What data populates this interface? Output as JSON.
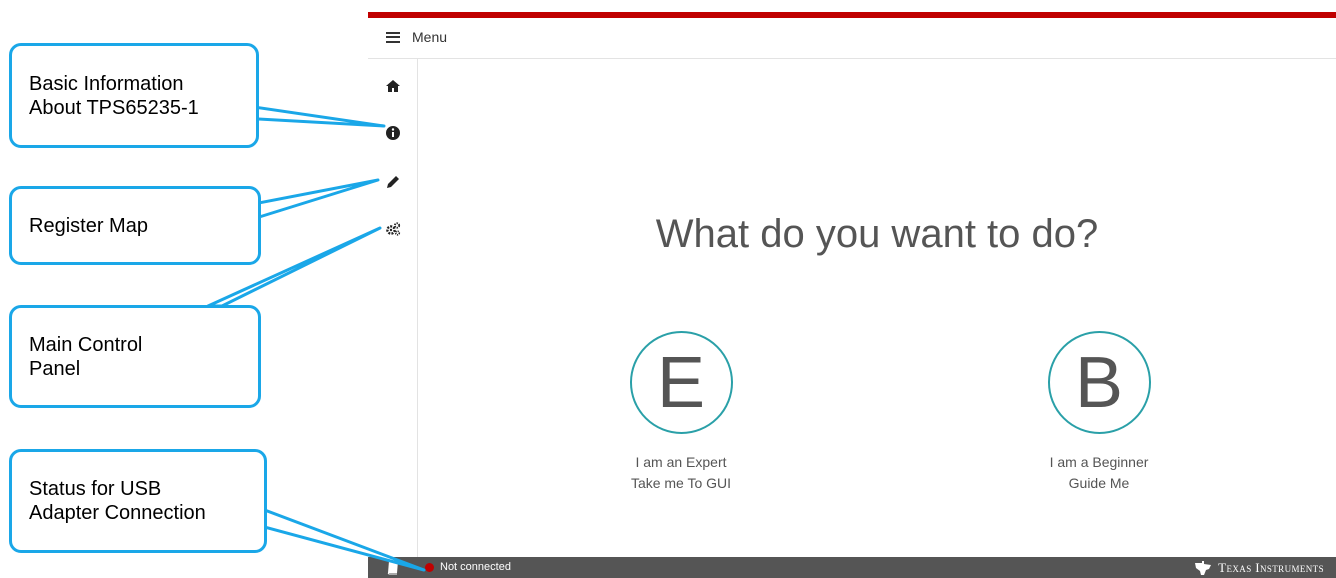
{
  "menu": {
    "label": "Menu"
  },
  "sidebar": {
    "items": [
      {
        "icon": "home-icon"
      },
      {
        "icon": "info-icon"
      },
      {
        "icon": "pencil-icon"
      },
      {
        "icon": "gears-icon"
      }
    ]
  },
  "main": {
    "question": "What do you want to do?",
    "choices": [
      {
        "letter": "E",
        "line1": "I am an Expert",
        "line2": "Take me To GUI"
      },
      {
        "letter": "B",
        "line1": "I am a Beginner",
        "line2": "Guide Me"
      }
    ]
  },
  "status": {
    "text": "Not connected",
    "brand": "Texas Instruments"
  },
  "callouts": {
    "info": "Basic Information\nAbout TPS65235-1",
    "register": "Register Map",
    "control": "Main Control\nPanel",
    "usb": "Status for USB\nAdapter Connection"
  },
  "colors": {
    "accent_red": "#c00000",
    "circle_teal": "#2aa0a8",
    "callout_blue": "#1aa7e8",
    "status_gray": "#555555"
  }
}
